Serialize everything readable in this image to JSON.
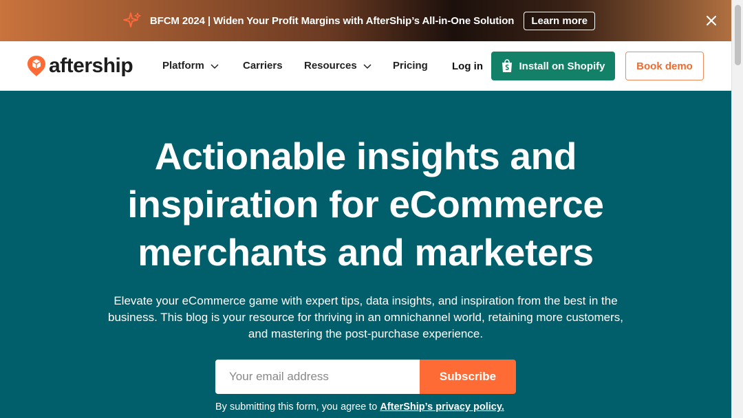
{
  "promo": {
    "text": "BFCM 2024 | Widen Your Profit Margins with AfterShip’s All-in-One Solution",
    "button": "Learn more"
  },
  "header": {
    "logo_text": "aftership",
    "nav": [
      {
        "label": "Platform",
        "dropdown": true
      },
      {
        "label": "Carriers",
        "dropdown": false
      },
      {
        "label": "Resources",
        "dropdown": true
      },
      {
        "label": "Pricing",
        "dropdown": false
      }
    ],
    "login": "Log in",
    "shopify_button": "Install on Shopify",
    "demo_button": "Book demo"
  },
  "hero": {
    "title_lines": [
      "Actionable insights and",
      "inspiration for eCommerce",
      "merchants and marketers"
    ],
    "description_lines": [
      "Elevate your eCommerce game with expert tips, data insights, and inspiration from the best in the",
      "business. This blog is your resource for thriving in an omnichannel world, retaining more customers,",
      "and mastering the post-purchase experience."
    ],
    "email_placeholder": "Your email address",
    "subscribe_button": "Subscribe",
    "consent_prefix": "By submitting this form, you agree to ",
    "consent_link": "AfterShip’s privacy policy."
  },
  "colors": {
    "hero_bg": "#005f6b",
    "accent_orange": "#ff6b35",
    "shopify_green": "#128167"
  },
  "icons": [
    "sparkle-icon",
    "close-icon",
    "aftership-logo-icon",
    "chevron-down-icon",
    "shopify-bag-icon"
  ]
}
